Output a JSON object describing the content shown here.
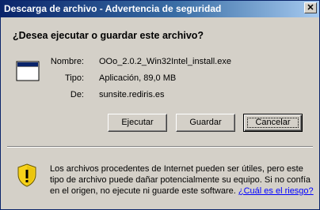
{
  "window": {
    "title": "Descarga de archivo - Advertencia de seguridad",
    "close_glyph": "✕"
  },
  "prompt": {
    "heading": "¿Desea ejecutar o guardar este archivo?"
  },
  "file": {
    "icon": "application-window-icon",
    "name_label": "Nombre:",
    "name_value": "OOo_2.0.2_Win32Intel_install.exe",
    "type_label": "Tipo:",
    "type_value": "Aplicación, 89,0 MB",
    "from_label": "De:",
    "from_value": "sunsite.rediris.es"
  },
  "buttons": {
    "run": "Ejecutar",
    "save": "Guardar",
    "cancel": "Cancelar"
  },
  "warning": {
    "icon": "security-shield-icon",
    "line1": "Los archivos procedentes de Internet pueden ser útiles, pero este",
    "line2": "tipo de archivo puede dañar potencialmente su equipo. Si no confía",
    "line3_text": "en el origen, no ejecute ni guarde este software.",
    "link": "¿Cuál es el riesgo?"
  },
  "colors": {
    "title_start": "#0a246a",
    "title_end": "#a6caf0",
    "dialog_bg": "#d4d0c8",
    "link": "#0000ff",
    "shield_yellow": "#f7d21a"
  }
}
